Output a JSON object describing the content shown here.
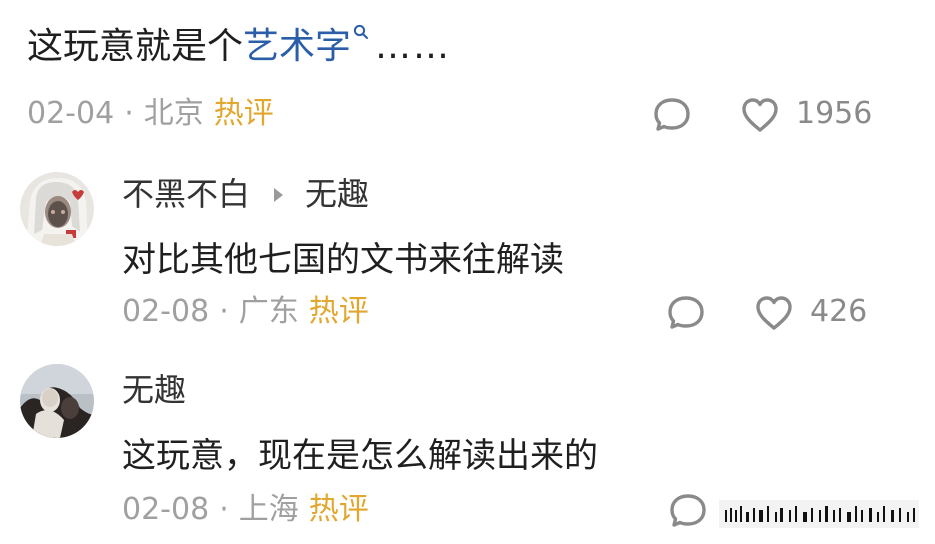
{
  "top_comment": {
    "text_prefix": "这玩意就是个",
    "link_text": "艺术字",
    "ellipsis": "……",
    "date": "02-04",
    "separator": "·",
    "location": "北京",
    "hot_badge": "热评",
    "like_count": "1956",
    "link_color": "#2a5ea8",
    "hot_color": "#e2a72e"
  },
  "replies": [
    {
      "author": "不黑不白",
      "reply_to": "无趣",
      "text": "对比其他七国的文书来往解读",
      "date": "02-08",
      "separator": "·",
      "location": "广东",
      "hot_badge": "热评",
      "like_count": "426"
    },
    {
      "author": "无趣",
      "text": "这玩意，现在是怎么解读出来的",
      "date": "02-08",
      "separator": "·",
      "location": "上海",
      "hot_badge": "热评"
    }
  ],
  "icons": {
    "comment": "comment-bubble-icon",
    "like": "heart-icon",
    "search": "search-icon",
    "reply_arrow": "play-triangle-icon"
  }
}
